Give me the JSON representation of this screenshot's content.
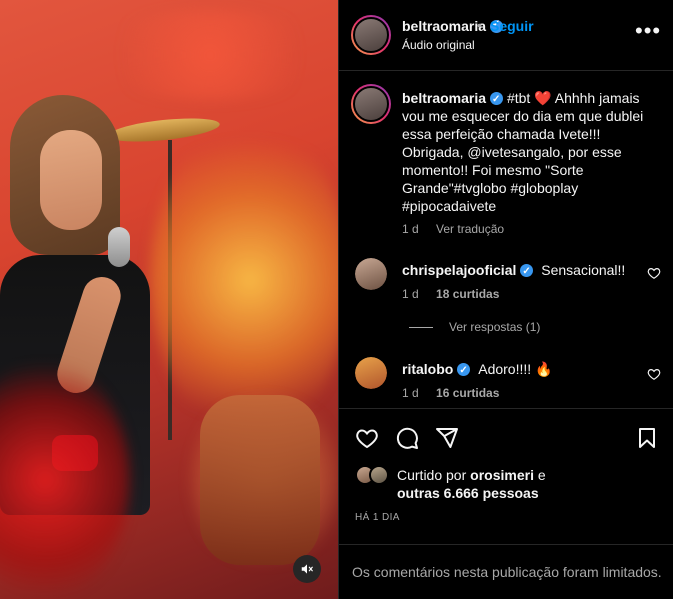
{
  "media": {
    "mute_icon": "speaker-muted-icon"
  },
  "header": {
    "username": "beltraomaria",
    "separator": "•",
    "follow_label": "Seguir",
    "audio_label": "Áudio original",
    "more_icon": "more-options-icon",
    "more_glyph": "•••"
  },
  "caption": {
    "username": "beltraomaria",
    "text": "#tbt ❤️ Ahhhh jamais vou me esquecer do dia em que dublei essa perfeição chamada Ivete!!! Obrigada, @ivetesangalo, por esse momento!! Foi mesmo \"Sorte Grande\"#tvglobo #globoplay #pipocadaivete",
    "age": "1 d",
    "translate_label": "Ver tradução"
  },
  "comments": [
    {
      "username": "chrispelajooficial",
      "text": "Sensacional!!",
      "age": "1 d",
      "likes": "18 curtidas",
      "replies_label": "Ver respostas (1)"
    },
    {
      "username": "ritalobo",
      "text": "Adoro!!!! 🔥",
      "age": "1 d",
      "likes": "16 curtidas"
    }
  ],
  "actions": {
    "like_icon": "heart-icon",
    "comment_icon": "comment-icon",
    "share_icon": "send-icon",
    "save_icon": "bookmark-icon"
  },
  "likes": {
    "prefix": "Curtido por",
    "first_user": "orosimeri",
    "joiner": "e",
    "others": "outras 6.666 pessoas"
  },
  "posted": "HÁ 1 DIA",
  "comments_limited": "Os comentários nesta publicação foram limitados.",
  "colors": {
    "accent": "#0095f6",
    "verified": "#3897f0",
    "background": "#000000",
    "muted_text": "#a8a8a8"
  }
}
